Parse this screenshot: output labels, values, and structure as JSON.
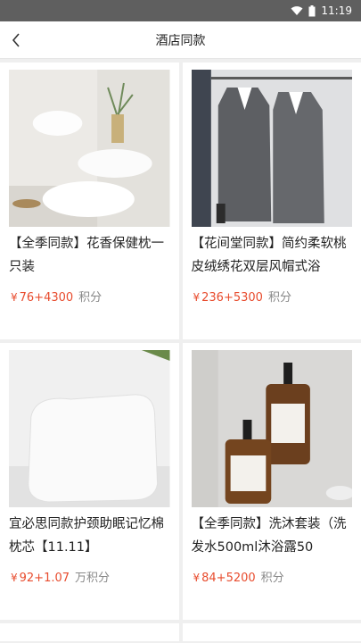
{
  "status": {
    "time": "11:19"
  },
  "header": {
    "title": "酒店同款"
  },
  "products": [
    {
      "title": "【全季同款】花香保健枕一只装",
      "price_prefix": "¥",
      "price_main": "76+4300",
      "price_suffix": "积分",
      "image": "white-pillows-photo"
    },
    {
      "title": "【花间堂同款】简约柔软桃皮绒绣花双层风帽式浴",
      "price_prefix": "¥",
      "price_main": "236+5300",
      "price_suffix": "积分",
      "image": "grey-bathrobes-photo"
    },
    {
      "title": "宜必思同款护颈助眠记忆棉枕芯【11.11】",
      "price_prefix": "¥",
      "price_main": "92+1.07",
      "price_suffix": "万积分",
      "image": "memory-foam-pillow-photo"
    },
    {
      "title": "【全季同款】洗沐套装（洗发水500ml沐浴露50",
      "price_prefix": "¥",
      "price_main": "84+5200",
      "price_suffix": "积分",
      "image": "amber-bottles-photo"
    }
  ],
  "colors": {
    "accent": "#e84c2e",
    "statusbar": "#5f5f5f"
  }
}
